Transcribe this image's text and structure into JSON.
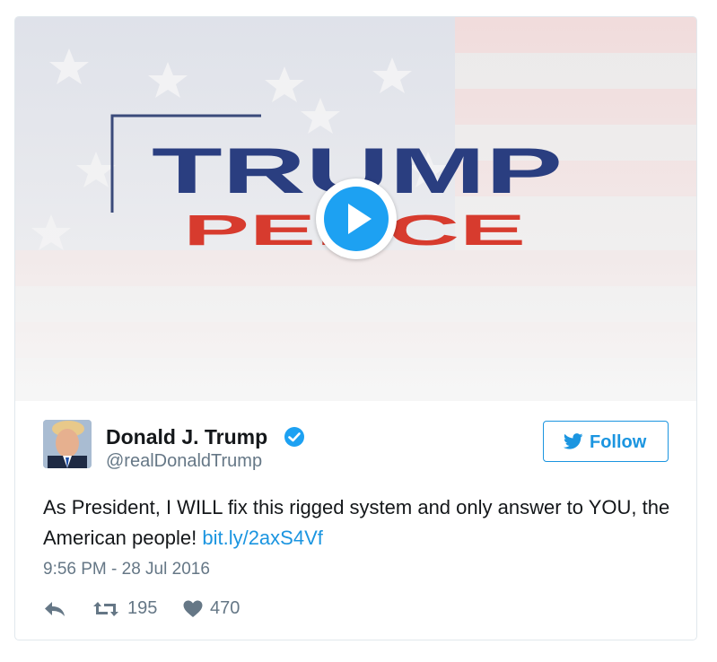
{
  "media": {
    "video_title_line1": "TRUMP",
    "video_title_line2": "PENCE",
    "play_icon": "play-icon",
    "colors": {
      "title_blue": "#2a3e80",
      "title_red": "#d73b2e",
      "play_blue": "#1da1f2"
    }
  },
  "author": {
    "name": "Donald J. Trump",
    "handle": "@realDonaldTrump",
    "verified_icon": "verified-badge-icon"
  },
  "follow_button": {
    "label": "Follow",
    "icon": "twitter-bird-icon"
  },
  "tweet": {
    "text": "As President, I WILL fix this rigged system and only answer to YOU, the American people!",
    "link_text": "bit.ly/2axS4Vf",
    "timestamp": "9:56 PM - 28 Jul 2016"
  },
  "actions": {
    "reply_icon": "reply-icon",
    "retweet_icon": "retweet-icon",
    "retweet_count": "195",
    "like_icon": "heart-icon",
    "like_count": "470"
  },
  "colors": {
    "accent": "#1b95e0",
    "text": "#14171a",
    "muted": "#657786",
    "border": "#e1e8ed"
  }
}
